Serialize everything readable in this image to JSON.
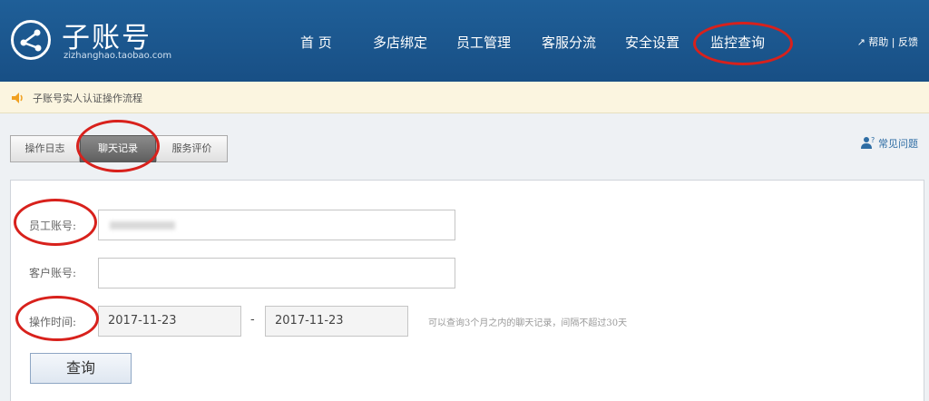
{
  "header": {
    "logo_title": "子账号",
    "logo_sub": "zizhanghao.taobao.com",
    "nav": [
      "首 页",
      "多店绑定",
      "员工管理",
      "客服分流",
      "安全设置",
      "监控查询"
    ],
    "help": "帮助",
    "separator": "|",
    "feedback": "反馈"
  },
  "announcement": {
    "text": "子账号实人认证操作流程"
  },
  "tabs": [
    "操作日志",
    "聊天记录",
    "服务评价"
  ],
  "faq": "常见问题",
  "form": {
    "employee_label": "员工账号:",
    "customer_label": "客户账号:",
    "time_label": "操作时间:",
    "start_date": "2017-11-23",
    "dash": "-",
    "end_date": "2017-11-23",
    "hint": "可以查询3个月之内的聊天记录，间隔不超过30天",
    "query_button": "查询"
  },
  "colors": {
    "header_bg": "#1b5590",
    "annotation_red": "#d8211c",
    "link": "#2e6da4"
  }
}
